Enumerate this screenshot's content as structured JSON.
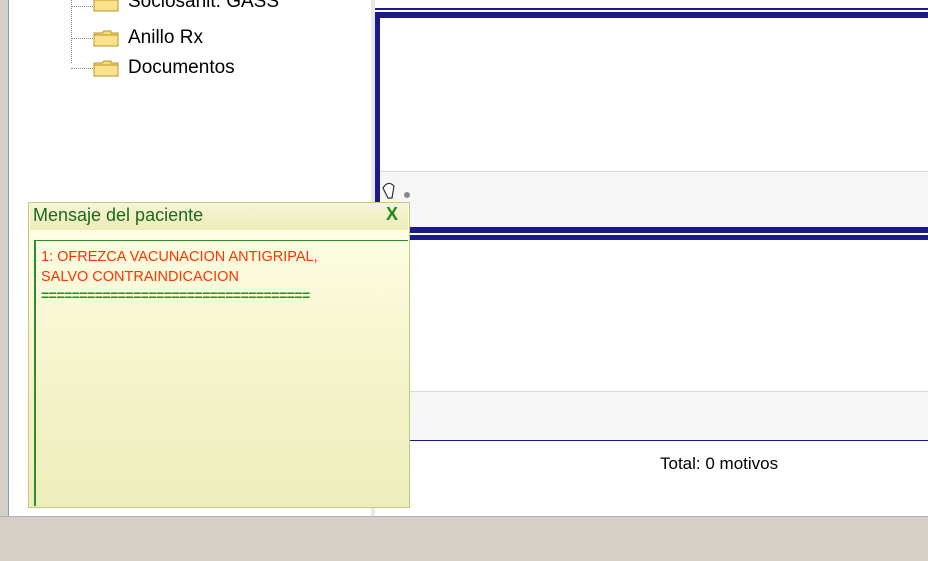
{
  "tree": {
    "items": [
      {
        "label": "Sociosanit. GASS",
        "icon": "folder-icon"
      },
      {
        "label": "Anillo Rx",
        "icon": "folder-icon"
      },
      {
        "label": "Documentos",
        "icon": "folder-icon"
      }
    ]
  },
  "popup": {
    "title": "Mensaje del paciente",
    "close_label": "X",
    "message_line1": "1: OFREZCA VACUNACION ANTIGRIPAL,",
    "message_line2": "SALVO CONTRAINDICACION",
    "separator": "==================================="
  },
  "footer": {
    "total_text": "Total:  0  motivos"
  },
  "colors": {
    "popup_title_text": "#1a6a1a",
    "message_text": "#ff3300",
    "panel_border": "#1a1a8a",
    "window_chrome": "#d4d0c8"
  }
}
